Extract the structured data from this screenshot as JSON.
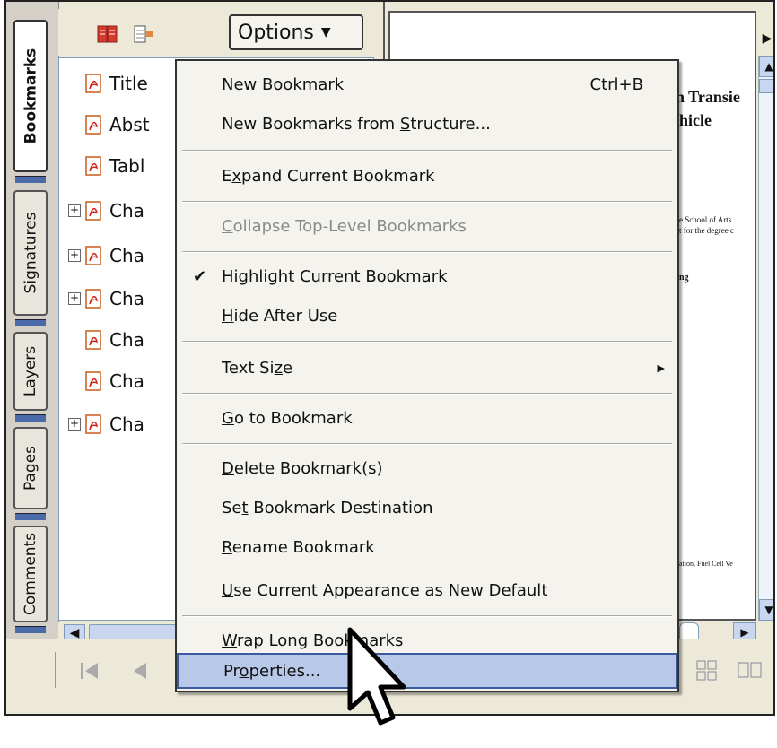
{
  "side_tabs": [
    "Bookmarks",
    "Signatures",
    "Layers",
    "Pages",
    "Comments"
  ],
  "toolbar": {
    "options_label": "Options",
    "options_caret": "▼",
    "close_label": "×"
  },
  "bookmarks": [
    {
      "label": "Title",
      "expander": ""
    },
    {
      "label": "Abst",
      "expander": ""
    },
    {
      "label": "Tabl",
      "expander": ""
    },
    {
      "label": "Cha",
      "expander": "+"
    },
    {
      "label": "Cha",
      "expander": "+"
    },
    {
      "label": "Cha",
      "expander": "+"
    },
    {
      "label": "Cha",
      "expander": ""
    },
    {
      "label": "Cha",
      "expander": ""
    },
    {
      "label": "Cha",
      "expander": "+"
    }
  ],
  "document": {
    "title_line1": "n Transie",
    "title_line2": "hicle",
    "line_a": "e School of Arts",
    "line_b": "t for the degree c",
    "line_c": "ng",
    "line_d": "ation, Fuel Cell Ve"
  },
  "menu": {
    "new_bookmark": {
      "pre": "New ",
      "u": "B",
      "post": "ookmark",
      "shortcut": "Ctrl+B"
    },
    "new_from_structure": {
      "pre": "New Bookmarks from ",
      "u": "S",
      "post": "tructure..."
    },
    "expand_current": {
      "pre": "E",
      "u": "x",
      "post": "pand Current Bookmark"
    },
    "collapse_top": {
      "pre": "",
      "u": "C",
      "post": "ollapse Top-Level Bookmarks"
    },
    "highlight_current": {
      "pre": "Highlight Current Book",
      "u": "m",
      "post": "ark",
      "check": "✔"
    },
    "hide_after_use": {
      "pre": "",
      "u": "H",
      "post": "ide After Use"
    },
    "text_size": {
      "pre": "Text Si",
      "u": "z",
      "post": "e",
      "arrow": "▶"
    },
    "go_to_bookmark": {
      "pre": "",
      "u": "G",
      "post": "o to Bookmark"
    },
    "delete_bookmark": {
      "pre": "",
      "u": "D",
      "post": "elete Bookmark(s)"
    },
    "set_destination": {
      "pre": "Se",
      "u": "t",
      "post": " Bookmark Destination"
    },
    "rename_bookmark": {
      "pre": "",
      "u": "R",
      "post": "ename Bookmark"
    },
    "use_current_appearance": {
      "pre": "",
      "u": "U",
      "post": "se Current Appearance as New Default"
    },
    "wrap_long": {
      "pre": "",
      "u": "W",
      "post": "rap Long Bookmarks"
    },
    "properties": {
      "pre": "Pr",
      "u": "o",
      "post": "perties..."
    }
  },
  "colors": {
    "accent": "#3c5aa0",
    "highlight": "#b8c8e8",
    "menu_bg": "#f4f3ee",
    "panel_bg": "#ece9d8"
  }
}
